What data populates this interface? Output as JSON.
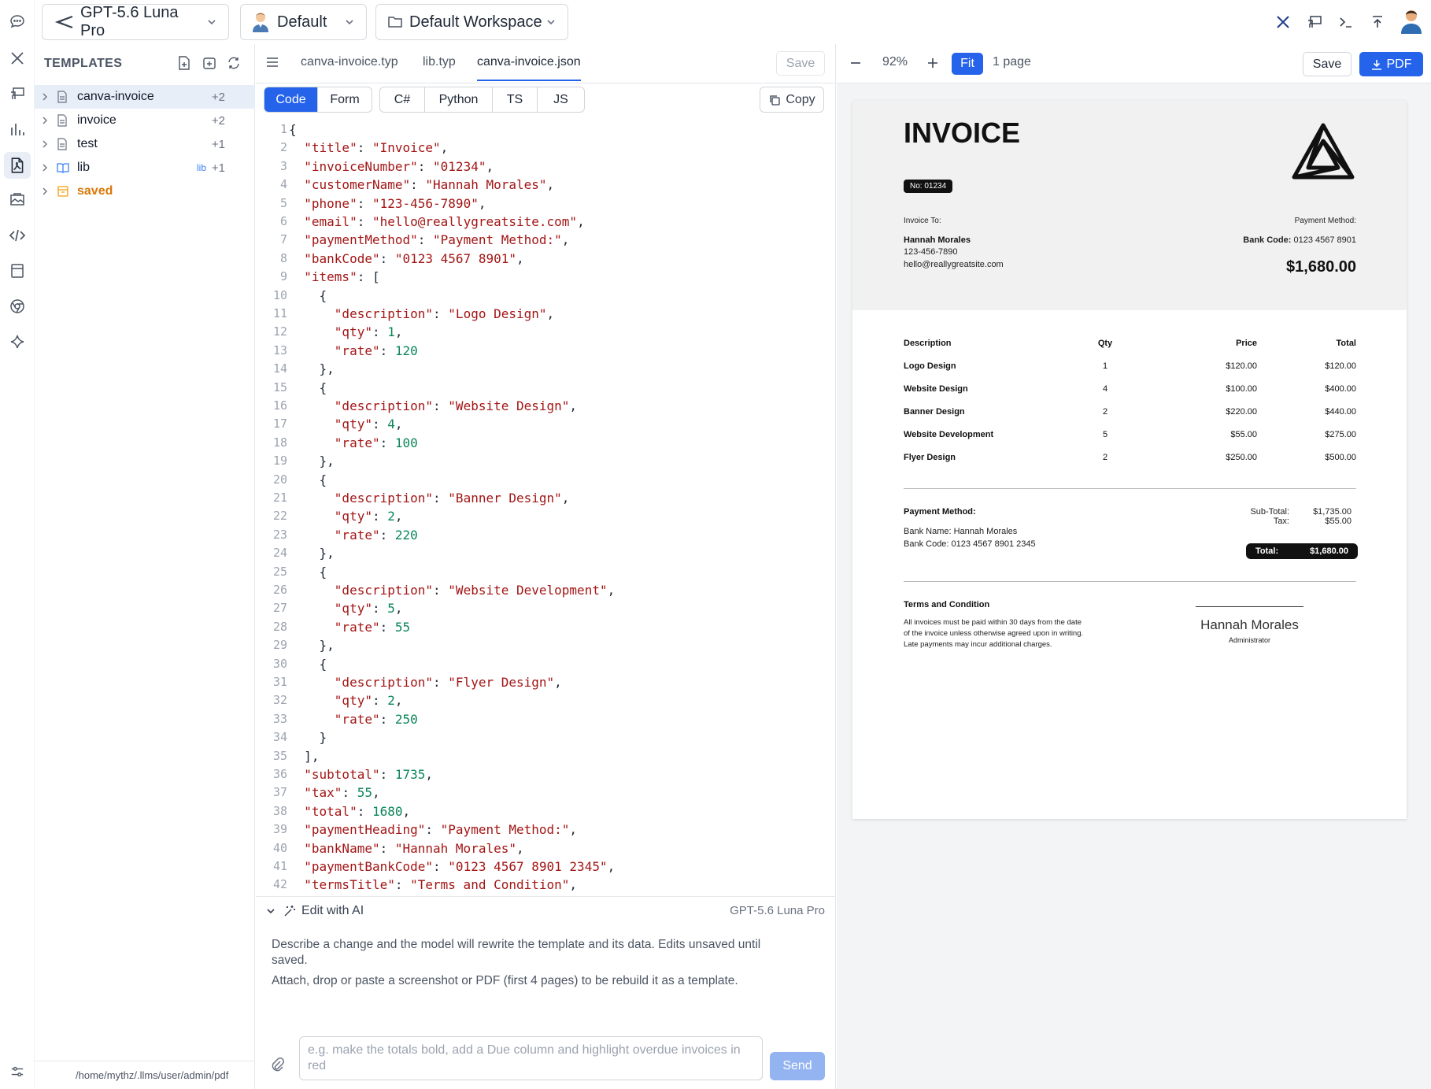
{
  "topbar": {
    "model": "GPT-5.6 Luna Pro",
    "profile": "Default",
    "workspace": "Default Workspace"
  },
  "sidebar": {
    "title": "TEMPLATES",
    "items": [
      {
        "name": "canva-invoice",
        "count": "+2",
        "tag": ""
      },
      {
        "name": "invoice",
        "count": "+2",
        "tag": ""
      },
      {
        "name": "test",
        "count": "+1",
        "tag": ""
      },
      {
        "name": "lib",
        "count": "+1",
        "tag": "lib"
      },
      {
        "name": "saved",
        "count": "",
        "tag": ""
      }
    ],
    "path": "/home/mythz/.llms/user/admin/pdf"
  },
  "editor": {
    "tabs": [
      "canva-invoice.typ",
      "lib.typ",
      "canva-invoice.json"
    ],
    "active_tab": "canva-invoice.json",
    "save_label": "Save",
    "modes": [
      "Code",
      "Form"
    ],
    "active_mode": "Code",
    "langs": [
      "C#",
      "Python",
      "TS",
      "JS"
    ],
    "copy_label": "Copy",
    "lines": [
      "{",
      "  \"title\": \"Invoice\",",
      "  \"invoiceNumber\": \"01234\",",
      "  \"customerName\": \"Hannah Morales\",",
      "  \"phone\": \"123-456-7890\",",
      "  \"email\": \"hello@reallygreatsite.com\",",
      "  \"paymentMethod\": \"Payment Method:\",",
      "  \"bankCode\": \"0123 4567 8901\",",
      "  \"items\": [",
      "    {",
      "      \"description\": \"Logo Design\",",
      "      \"qty\": 1,",
      "      \"rate\": 120",
      "    },",
      "    {",
      "      \"description\": \"Website Design\",",
      "      \"qty\": 4,",
      "      \"rate\": 100",
      "    },",
      "    {",
      "      \"description\": \"Banner Design\",",
      "      \"qty\": 2,",
      "      \"rate\": 220",
      "    },",
      "    {",
      "      \"description\": \"Website Development\",",
      "      \"qty\": 5,",
      "      \"rate\": 55",
      "    },",
      "    {",
      "      \"description\": \"Flyer Design\",",
      "      \"qty\": 2,",
      "      \"rate\": 250",
      "    }",
      "  ],",
      "  \"subtotal\": 1735,",
      "  \"tax\": 55,",
      "  \"total\": 1680,",
      "  \"paymentHeading\": \"Payment Method:\",",
      "  \"bankName\": \"Hannah Morales\",",
      "  \"paymentBankCode\": \"0123 4567 8901 2345\",",
      "  \"termsTitle\": \"Terms and Condition\","
    ],
    "ai": {
      "title": "Edit with AI",
      "model": "GPT-5.6 Luna Pro",
      "desc1": "Describe a change and the model will rewrite the template and its data. Edits unsaved until saved.",
      "desc2": "Attach, drop or paste a screenshot or PDF (first 4 pages) to be rebuild it as a template.",
      "placeholder": "e.g. make the totals bold, add a Due column and highlight overdue invoices in red",
      "send_label": "Send"
    }
  },
  "preview": {
    "zoom": "92%",
    "fit_label": "Fit",
    "pages": "1 page",
    "save_label": "Save",
    "pdf_label": "PDF"
  },
  "invoice": {
    "title": "INVOICE",
    "number": "No: 01234",
    "to_label": "Invoice To:",
    "customer": "Hannah Morales",
    "phone": "123-456-7890",
    "email": "hello@reallygreatsite.com",
    "pm_label": "Payment Method:",
    "bank_code_label": "Bank Code:",
    "bank_code": "0123 4567 8901",
    "amount": "$1,680.00",
    "headers": [
      "Description",
      "Qty",
      "Price",
      "Total"
    ],
    "rows": [
      [
        "Logo Design",
        "1",
        "$120.00",
        "$120.00"
      ],
      [
        "Website Design",
        "4",
        "$100.00",
        "$400.00"
      ],
      [
        "Banner Design",
        "2",
        "$220.00",
        "$440.00"
      ],
      [
        "Website Development",
        "5",
        "$55.00",
        "$275.00"
      ],
      [
        "Flyer Design",
        "2",
        "$250.00",
        "$500.00"
      ]
    ],
    "payment_heading": "Payment Method:",
    "bank_name_line": "Bank Name:  Hannah Morales",
    "bank_code_line": "Bank Code:  0123 4567 8901 2345",
    "subtotal_label": "Sub-Total:",
    "subtotal": "$1,735.00",
    "tax_label": "Tax:",
    "tax": "$55.00",
    "total_label": "Total:",
    "total": "$1,680.00",
    "terms_title": "Terms and Condition",
    "terms_1": "All invoices must be paid within 30 days from the date",
    "terms_2": "of the invoice unless otherwise agreed upon in writing.",
    "terms_3": "Late payments may incur additional charges.",
    "signer": "Hannah Morales",
    "signer_role": "Administrator"
  }
}
